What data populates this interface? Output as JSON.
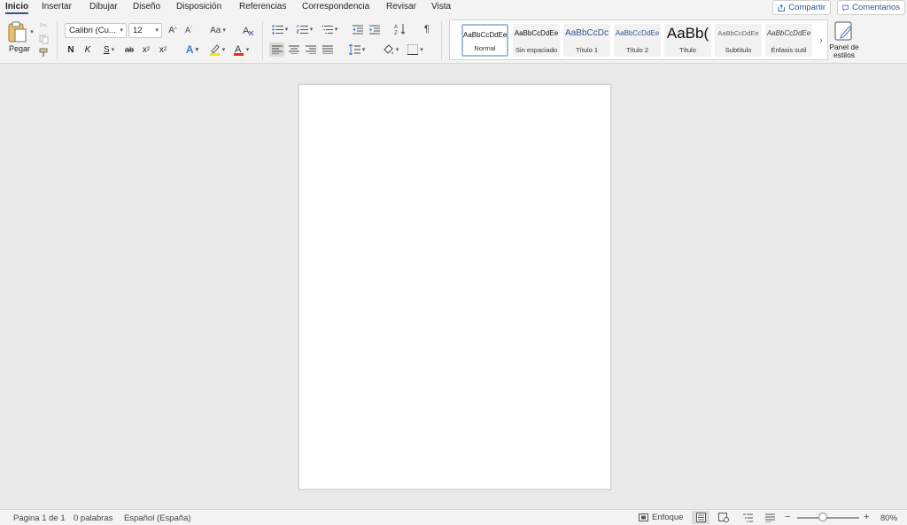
{
  "menu": {
    "tabs": [
      {
        "label": "Inicio",
        "active": true
      },
      {
        "label": "Insertar"
      },
      {
        "label": "Dibujar"
      },
      {
        "label": "Diseño"
      },
      {
        "label": "Disposición"
      },
      {
        "label": "Referencias"
      },
      {
        "label": "Correspondencia"
      },
      {
        "label": "Revisar"
      },
      {
        "label": "Vista"
      }
    ],
    "share_label": "Compartir",
    "comments_label": "Comentarios"
  },
  "ribbon": {
    "paste_label": "Pegar",
    "font_name": "Calibri (Cu...",
    "font_size": "12",
    "grow_font": "A",
    "shrink_font": "A",
    "change_case": "Aa",
    "bold": "N",
    "italic": "K",
    "underline": "S",
    "strikethrough": "ab",
    "subscript": "x",
    "superscript": "x",
    "text_effects": "A",
    "font_color": "A",
    "highlight_color": "#f2e30a",
    "font_color_value": "#e0312d",
    "pilcrow": "¶",
    "styles_pane_label": "Panel de estilos",
    "icons": [
      "paste-icon",
      "cut-icon",
      "copy-icon",
      "format-painter-icon",
      "clear-formatting-icon",
      "bullets-icon",
      "numbering-icon",
      "multilevel-list-icon",
      "decrease-indent-icon",
      "increase-indent-icon",
      "sort-icon",
      "show-formatting-icon",
      "align-left-icon",
      "align-center-icon",
      "align-right-icon",
      "justify-icon",
      "line-spacing-icon",
      "shading-icon",
      "borders-icon",
      "styles-pane-icon"
    ]
  },
  "styles": [
    {
      "sample": "AaBbCcDdEe",
      "name": "Normal"
    },
    {
      "sample": "AaBbCcDdEe",
      "name": "Sin espaciado"
    },
    {
      "sample": "AaBbCcDc",
      "name": "Título 1"
    },
    {
      "sample": "AaBbCcDdEe",
      "name": "Título 2"
    },
    {
      "sample": "AaBb(",
      "name": "Título"
    },
    {
      "sample": "AaBbCcDdEe",
      "name": "Subtítulo"
    },
    {
      "sample": "AaBbCcDdEe",
      "name": "Énfasis sutil"
    }
  ],
  "status": {
    "page": "Página 1 de 1",
    "words": "0 palabras",
    "language": "Español (España)",
    "focus": "Enfoque",
    "zoom_minus": "−",
    "zoom_plus": "+",
    "zoom": "80%",
    "zoom_level_percent": 80
  },
  "colors": {
    "accent": "#2b579a"
  }
}
